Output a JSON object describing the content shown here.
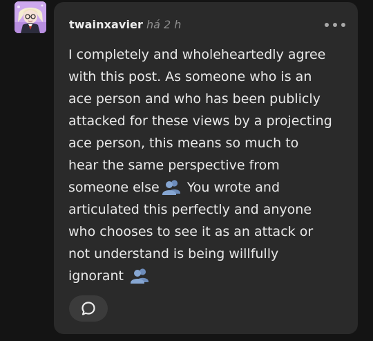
{
  "post": {
    "author": "twainxavier",
    "timestamp": "há 2 h",
    "more_icon": "more-horizontal-icon",
    "body_lines": [
      "I completely and wholeheartedly agree",
      "with this post. As someone who is an",
      "ace person and who has been publicly",
      "attacked for these views by a projecting",
      "ace person, this means so much to",
      "hear the same perspective from",
      "someone else",
      " You wrote and",
      "articulated this perfectly and anyone",
      "who chooses to see it as an attack or",
      "not understand is being willfully",
      "ignorant"
    ],
    "emoji": "busts-in-silhouette-emoji",
    "reply_icon": "speech-bubble-icon"
  },
  "colors": {
    "background": "#141414",
    "card": "#2a2a2a",
    "text": "#e9e9e9",
    "muted": "#8d8d8d",
    "emoji": "#7f9fc8",
    "avatar": "#c9a6e8"
  }
}
